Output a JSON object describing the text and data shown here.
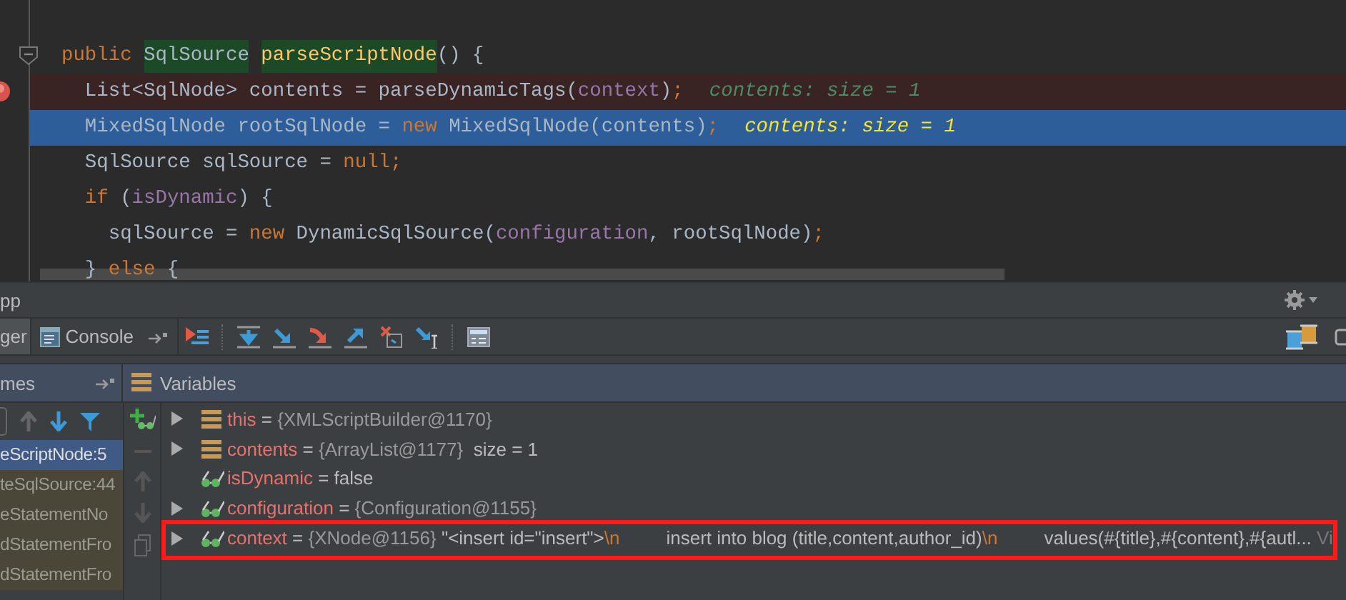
{
  "editor": {
    "lines": [
      {
        "kind": "normal",
        "fold": true,
        "tokens": [
          {
            "text": "public",
            "kind": "keyword"
          },
          {
            "text": "SqlSource",
            "kind": "usage"
          },
          {
            "text": "parseScriptNode",
            "kind": "usage-method"
          },
          {
            "text": "() {",
            "kind": "plain"
          }
        ]
      },
      {
        "kind": "breakpoint",
        "tokens": [
          {
            "text": "  List<SqlNode> contents = parseDynamicTags(",
            "kind": "plain"
          },
          {
            "text": "context",
            "kind": "field"
          },
          {
            "text": ")",
            "kind": "plain"
          },
          {
            "text": ";",
            "kind": "keyword"
          }
        ],
        "inline_value": "contents:  size = 1"
      },
      {
        "kind": "current",
        "tokens": [
          {
            "text": "  MixedSqlNode rootSqlNode = ",
            "kind": "plain"
          },
          {
            "text": "new",
            "kind": "keyword"
          },
          {
            "text": " MixedSqlNode(contents)",
            "kind": "plain"
          },
          {
            "text": ";",
            "kind": "keyword"
          }
        ],
        "inline_value": "contents:  size = 1"
      },
      {
        "kind": "normal",
        "tokens": [
          {
            "text": "  SqlSource sqlSource = ",
            "kind": "plain"
          },
          {
            "text": "null;",
            "kind": "keyword"
          }
        ]
      },
      {
        "kind": "normal",
        "tokens": [
          {
            "text": "  if",
            "kind": "keyword"
          },
          {
            "text": " (",
            "kind": "plain"
          },
          {
            "text": "isDynamic",
            "kind": "field"
          },
          {
            "text": ") {",
            "kind": "plain"
          }
        ]
      },
      {
        "kind": "normal",
        "tokens": [
          {
            "text": "    sqlSource = ",
            "kind": "plain"
          },
          {
            "text": "new",
            "kind": "keyword"
          },
          {
            "text": " DynamicSqlSource(",
            "kind": "plain"
          },
          {
            "text": "configuration",
            "kind": "field"
          },
          {
            "text": ", rootSqlNode)",
            "kind": "plain"
          },
          {
            "text": ";",
            "kind": "keyword"
          }
        ]
      },
      {
        "kind": "normal",
        "tokens": [
          {
            "text": "  } ",
            "kind": "plain"
          },
          {
            "text": "else",
            "kind": "keyword"
          },
          {
            "text": " {",
            "kind": "plain"
          }
        ]
      }
    ]
  },
  "tool_window": {
    "title": "pp"
  },
  "tabs": [
    {
      "label": "ger",
      "selected": true
    },
    {
      "label": "Console",
      "selected": false
    }
  ],
  "frames": {
    "title": "mes",
    "items": [
      {
        "label": "eScriptNode:5",
        "selected": true
      },
      {
        "label": "teSqlSource:44",
        "selected": false
      },
      {
        "label": "eStatementNo",
        "selected": false
      },
      {
        "label": "dStatementFro",
        "selected": false
      },
      {
        "label": "dStatementFro",
        "selected": false
      }
    ]
  },
  "variables": {
    "title": "Variables",
    "items": [
      {
        "kind": "object",
        "expandable": true,
        "name": "this",
        "separator": "=",
        "value": "{XMLScriptBuilder@1170}"
      },
      {
        "kind": "object",
        "expandable": true,
        "name": "contents",
        "separator": "=",
        "value": "{ArrayList@1177}",
        "parts": [
          {
            "text": "  size = 1",
            "kind": "plain"
          }
        ]
      },
      {
        "kind": "field",
        "expandable": false,
        "name": "isDynamic",
        "separator": "=",
        "parts": [
          {
            "text": "false",
            "kind": "plain"
          }
        ]
      },
      {
        "kind": "field",
        "expandable": true,
        "name": "configuration",
        "separator": "=",
        "value": "{Configuration@1155}"
      },
      {
        "kind": "field",
        "expandable": true,
        "highlighted": true,
        "name": "context",
        "separator": "=",
        "value": "{XNode@1156}",
        "parts": [
          {
            "text": " \"<insert id=\"insert\">",
            "kind": "plain"
          },
          {
            "text": "\\n",
            "kind": "escape"
          },
          {
            "text": "         insert into blog (title,content,author_id)",
            "kind": "plain"
          },
          {
            "text": "\\n",
            "kind": "escape"
          },
          {
            "text": "         values(#{title},#{content},#{autl...",
            "kind": "plain"
          },
          {
            "text": " Vi",
            "kind": "link"
          }
        ]
      }
    ]
  }
}
